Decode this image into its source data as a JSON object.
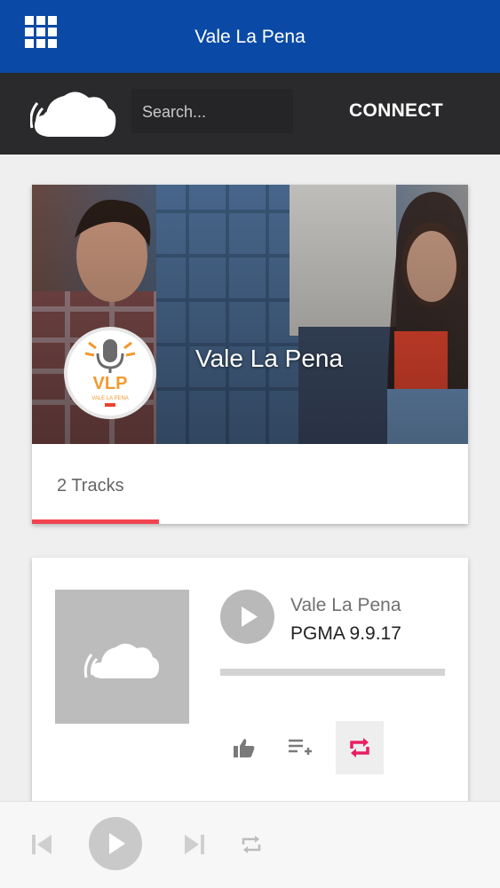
{
  "app": {
    "title": "Vale La Pena",
    "menu_icon": "grid-icon"
  },
  "toolbar": {
    "logo_icon": "soundcloud-cloud-icon",
    "search_placeholder": "Search...",
    "connect_label": "CONNECT"
  },
  "artist": {
    "name": "Vale La Pena",
    "avatar_text": "VLP",
    "avatar_subtext": "VALE LA PENA",
    "tabs": [
      {
        "label": "2 Tracks",
        "active": true
      }
    ]
  },
  "track": {
    "artist": "Vale La Pena",
    "title": "PGMA 9.9.17",
    "progress": 0,
    "artwork_icon": "soundcloud-cloud-icon",
    "actions": [
      {
        "name": "like-icon"
      },
      {
        "name": "add-to-queue-icon"
      },
      {
        "name": "repost-icon",
        "color": "#e91e63"
      }
    ]
  },
  "player": {
    "controls": [
      "previous-icon",
      "play-icon",
      "next-icon",
      "repeat-icon"
    ]
  },
  "colors": {
    "appbar": "#0a4aa6",
    "toolbar": "#2a2a2c",
    "accent": "#f2434f",
    "repost": "#e91e63"
  }
}
